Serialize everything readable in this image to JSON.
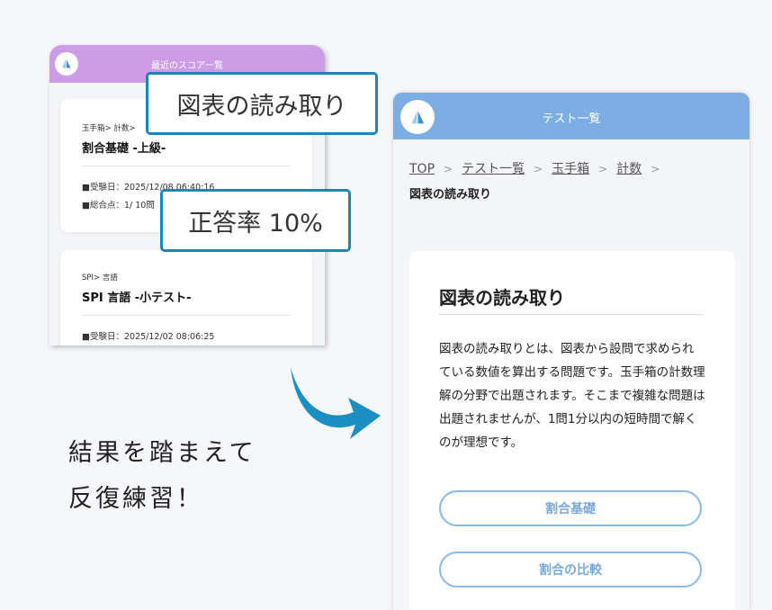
{
  "left_screen": {
    "header_title": "最近のスコア一覧",
    "logo_icon": "app-logo-icon",
    "cards": [
      {
        "crumb": "玉手箱>  計数>",
        "title": "割合基礎 -上級-",
        "date": "■受験日：2025/12/08 06:40:16",
        "score": "■総合点：1/ 10問"
      },
      {
        "crumb": "SPI>  言語",
        "title": "SPI 言語 -小テスト-",
        "date": "■受験日：2025/12/02 08:06:25"
      }
    ]
  },
  "callouts": {
    "topic": "図表の読み取り",
    "accuracy": "正答率 10%"
  },
  "tagline": {
    "line1": "結果を踏まえて",
    "line2": "反復練習！"
  },
  "right_screen": {
    "header_title": "テスト一覧",
    "logo_icon": "app-logo-icon",
    "breadcrumb": [
      "TOP",
      "テスト一覧",
      "玉手箱",
      "計数"
    ],
    "current": "図表の読み取り",
    "card": {
      "title": "図表の読み取り",
      "description": "図表の読み取りとは、図表から設問で求められている数値を算出する問題です。玉手箱の計数理解の分野で出題されます。そこまで複雑な問題は出題されませんが、1問1分以内の短時間で解くのが理想です。",
      "buttons": [
        "割合基礎",
        "割合の比較"
      ]
    }
  },
  "colors": {
    "left_header": "#cc9de6",
    "right_header": "#7caee3",
    "callout_border": "#1e85b4",
    "arrow": "#1b8fc2",
    "button_border": "#8bb8e6"
  }
}
